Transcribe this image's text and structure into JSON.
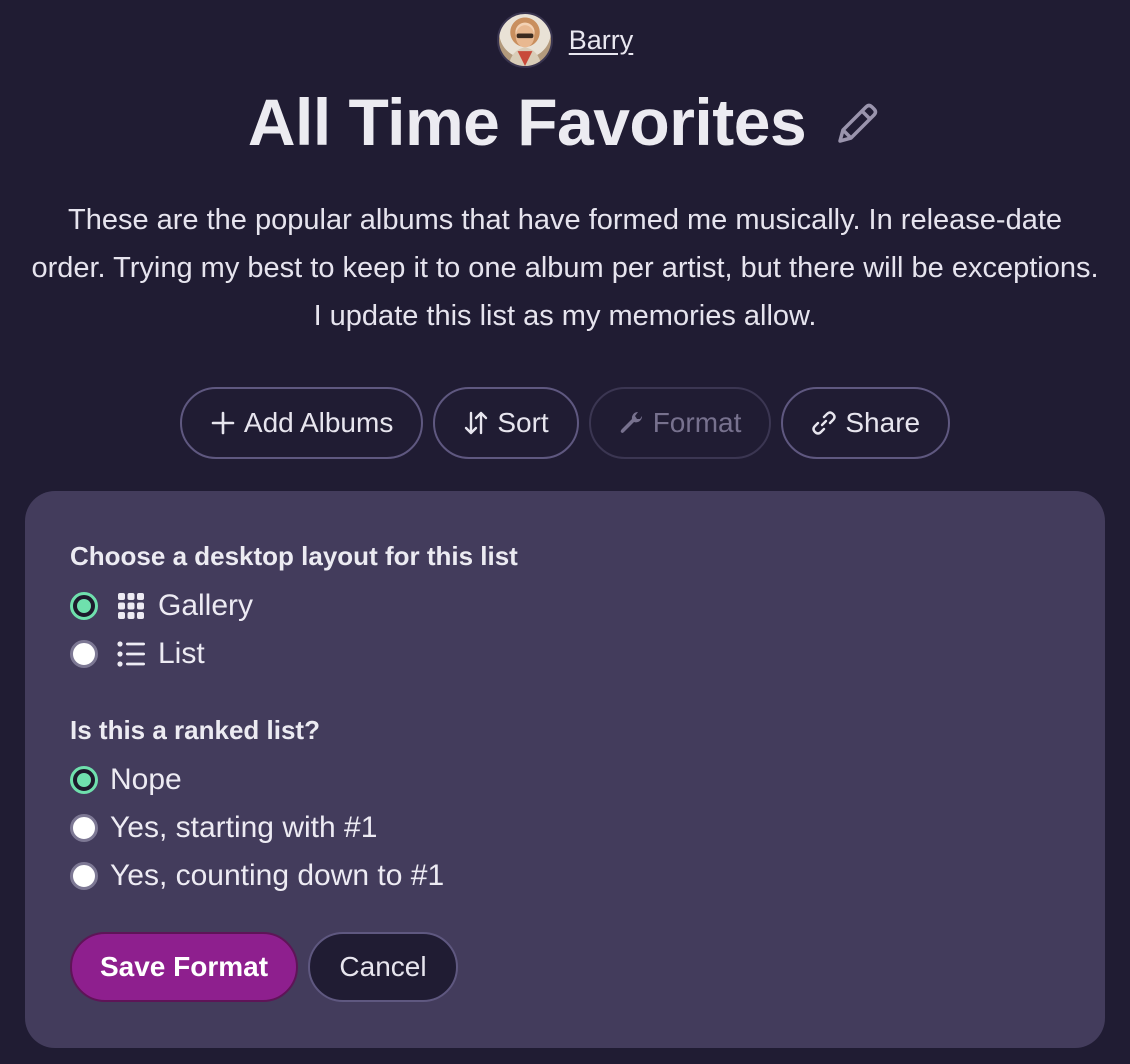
{
  "user": {
    "name": "Barry",
    "avatar_icon": "avatar-photo"
  },
  "list": {
    "title": "All Time Favorites",
    "edit_icon": "pencil-icon",
    "description": "These are the popular albums that have formed me musically. In release-date order. Trying my best to keep it to one album per artist, but there will be exceptions. I update this list as my memories allow."
  },
  "actions": {
    "add_albums": "Add Albums",
    "sort": "Sort",
    "format": "Format",
    "share": "Share"
  },
  "format_panel": {
    "layout_question": "Choose a desktop layout for this list",
    "layout_options": [
      {
        "label": "Gallery",
        "icon": "grid-icon",
        "selected": true
      },
      {
        "label": "List",
        "icon": "list-icon",
        "selected": false
      }
    ],
    "ranked_question": "Is this a ranked list?",
    "ranked_options": [
      {
        "label": "Nope",
        "selected": true
      },
      {
        "label": "Yes, starting with #1",
        "selected": false
      },
      {
        "label": "Yes, counting down to #1",
        "selected": false
      }
    ],
    "save_label": "Save Format",
    "cancel_label": "Cancel"
  },
  "colors": {
    "background": "#201c33",
    "panel": "#433c5c",
    "accent_radio": "#6fe0ad",
    "save_button": "#8e1f8e"
  }
}
